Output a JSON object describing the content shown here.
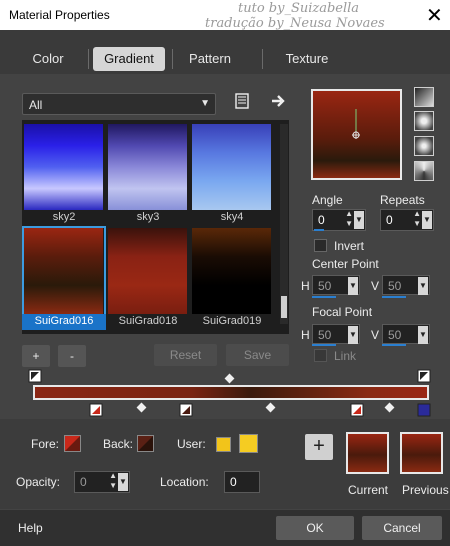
{
  "window": {
    "title": "Material Properties",
    "watermark_1": "tuto by_Suizabella",
    "watermark_2": "tradução by_Neusa Novaes",
    "close_label": "✕"
  },
  "tabs": [
    {
      "label": "Color",
      "active": false
    },
    {
      "label": "Gradient",
      "active": true
    },
    {
      "label": "Pattern",
      "active": false
    },
    {
      "label": "Texture",
      "active": false
    }
  ],
  "category_select": {
    "value": "All"
  },
  "icons": {
    "library": "library-icon",
    "forward": "arrow-right-icon",
    "add_swatch": "plus-icon"
  },
  "gradients": [
    {
      "name": "sky2",
      "colors": [
        "#1a10a8",
        "#2a20e8",
        "#5060f0",
        "#c8c8ff",
        "#2a28c0"
      ]
    },
    {
      "name": "sky3",
      "colors": [
        "#201860",
        "#5048b0",
        "#8a88d8",
        "#c0c4f0",
        "#8890d8"
      ]
    },
    {
      "name": "sky4",
      "colors": [
        "#3840b8",
        "#5878e0",
        "#7aa8f0",
        "#a8c8f0"
      ]
    },
    {
      "name": "SuiGrad016",
      "colors": [
        "#9a2612",
        "#5a1c0c",
        "#2a1a0a",
        "#8a2a12"
      ],
      "selected": true
    },
    {
      "name": "SuiGrad018",
      "colors": [
        "#3a120c",
        "#8a2214",
        "#9a2814",
        "#7a1e10"
      ]
    },
    {
      "name": "SuiGrad019",
      "colors": [
        "#5a2808",
        "#1a0c04",
        "#000000",
        "#000000"
      ]
    }
  ],
  "buttons": {
    "add": "+",
    "remove": "-",
    "reset": "Reset",
    "save": "Save"
  },
  "angle": {
    "label": "Angle",
    "value": "0"
  },
  "repeats": {
    "label": "Repeats",
    "value": "0"
  },
  "invert": {
    "label": "Invert",
    "checked": false
  },
  "center_point": {
    "label": "Center Point",
    "h_label": "H",
    "h": "50",
    "v_label": "V",
    "v": "50"
  },
  "focal_point": {
    "label": "Focal Point",
    "h_label": "H",
    "h": "50",
    "v_label": "V",
    "v": "50"
  },
  "link": {
    "label": "Link",
    "checked": false
  },
  "fore": {
    "label": "Fore:",
    "color": "#9a2612"
  },
  "back": {
    "label": "Back:",
    "color": "#4a1a10"
  },
  "user": {
    "label": "User:",
    "color_1": "#f2c41a",
    "color_2": "#f5cc22"
  },
  "opacity": {
    "label": "Opacity:",
    "value": "0"
  },
  "location": {
    "label": "Location:",
    "value": "0"
  },
  "current": {
    "label": "Current"
  },
  "previous": {
    "label": "Previous"
  },
  "footer": {
    "help": "Help",
    "ok": "OK",
    "cancel": "Cancel"
  },
  "colors": {
    "accent": "#1a73c8",
    "background": "#434343"
  }
}
